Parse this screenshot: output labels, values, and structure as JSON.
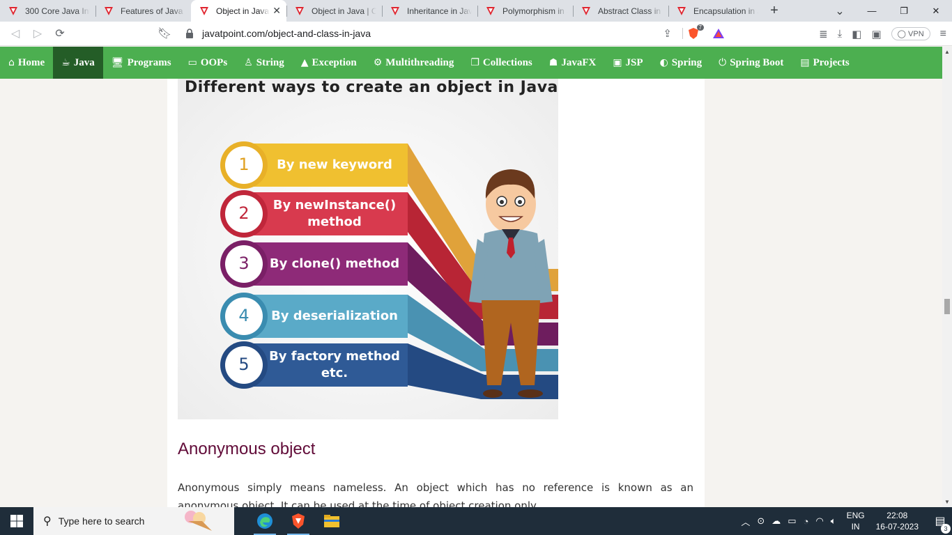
{
  "browser": {
    "tabs": [
      {
        "title": "300 Core Java Inter",
        "active": false
      },
      {
        "title": "Features of Java - J",
        "active": false
      },
      {
        "title": "Object in Java",
        "active": true
      },
      {
        "title": "Object in Java | Cla",
        "active": false
      },
      {
        "title": "Inheritance in Java",
        "active": false
      },
      {
        "title": "Polymorphism in Ja",
        "active": false
      },
      {
        "title": "Abstract Class in Ja",
        "active": false
      },
      {
        "title": "Encapsulation in Ja",
        "active": false
      }
    ],
    "url": "javatpoint.com/object-and-class-in-java",
    "vpn_label": "VPN",
    "shields_count": "7"
  },
  "site_nav": {
    "items": [
      {
        "label": "Home",
        "icon": "home-icon",
        "glyph": "⌂",
        "active": false
      },
      {
        "label": "Java",
        "icon": "java-cup-icon",
        "glyph": "☕",
        "active": true
      },
      {
        "label": "Programs",
        "icon": "monitor-icon",
        "glyph": "🖥",
        "active": false
      },
      {
        "label": "OOPs",
        "icon": "oops-icon",
        "glyph": "▭",
        "active": false
      },
      {
        "label": "String",
        "icon": "string-icon",
        "glyph": "♙",
        "active": false
      },
      {
        "label": "Exception",
        "icon": "warning-icon",
        "glyph": "▲",
        "active": false
      },
      {
        "label": "Multithreading",
        "icon": "thread-icon",
        "glyph": "⚙",
        "active": false
      },
      {
        "label": "Collections",
        "icon": "copy-icon",
        "glyph": "❐",
        "active": false
      },
      {
        "label": "JavaFX",
        "icon": "javafx-icon",
        "glyph": "☗",
        "active": false
      },
      {
        "label": "JSP",
        "icon": "jsp-icon",
        "glyph": "▣",
        "active": false
      },
      {
        "label": "Spring",
        "icon": "spring-icon",
        "glyph": "◐",
        "active": false
      },
      {
        "label": "Spring Boot",
        "icon": "power-icon",
        "glyph": "⏻",
        "active": false
      },
      {
        "label": "Projects",
        "icon": "projects-icon",
        "glyph": "▤",
        "active": false
      }
    ]
  },
  "article": {
    "figure": {
      "title": "Different ways to create an object in Java",
      "steps": [
        {
          "num": "1",
          "line1": "By new keyword",
          "line2": "",
          "color": "#f0c030",
          "num_color": "#e0a020"
        },
        {
          "num": "2",
          "line1": "By newInstance()",
          "line2": "method",
          "color": "#d83a4e",
          "num_color": "#c0263a"
        },
        {
          "num": "3",
          "line1": "By clone() method",
          "line2": "",
          "color": "#8e2a78",
          "num_color": "#7a1f66"
        },
        {
          "num": "4",
          "line1": "By deserialization",
          "line2": "",
          "color": "#5aaac8",
          "num_color": "#3a8cb0"
        },
        {
          "num": "5",
          "line1": "By factory method",
          "line2": "etc.",
          "color": "#2f5a96",
          "num_color": "#244a82"
        }
      ]
    },
    "section_heading": "Anonymous object",
    "body_text": "Anonymous simply means nameless. An object which has no reference is known as an anonymous object. It can be used at the time of object creation only."
  },
  "taskbar": {
    "search_placeholder": "Type here to search",
    "lang_top": "ENG",
    "lang_bottom": "IN",
    "time": "22:08",
    "date": "16-07-2023",
    "notification_count": "3"
  }
}
